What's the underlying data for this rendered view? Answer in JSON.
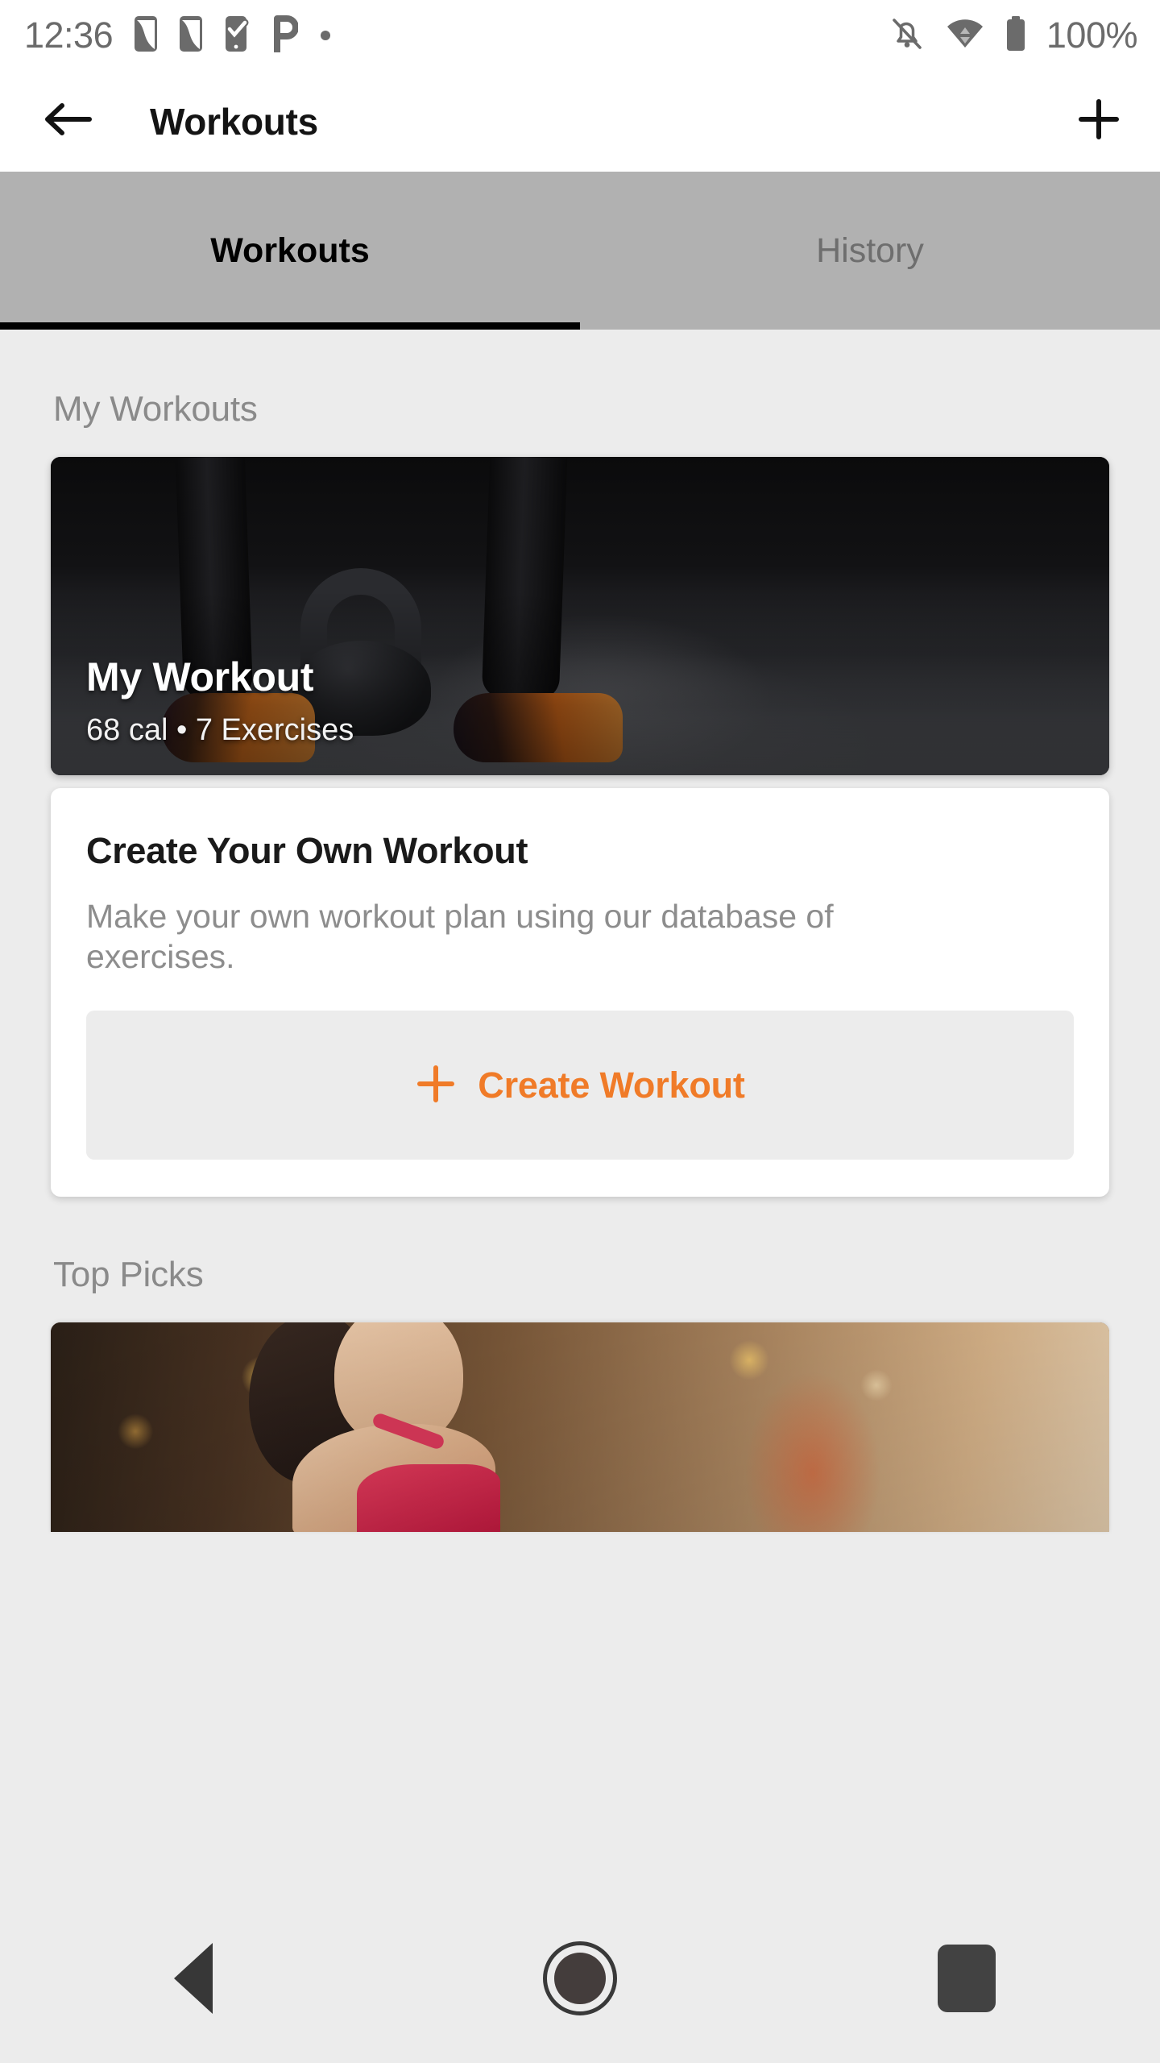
{
  "status_bar": {
    "time": "12:36",
    "battery_text": "100%",
    "left_icons": [
      "sim-card-icon",
      "sim-card-icon",
      "phone-check-icon",
      "pinterest-p-icon",
      "dot-icon"
    ],
    "right_icons": [
      "bell-off-icon",
      "wifi-icon",
      "battery-full-icon"
    ],
    "icon_color": "#6b6b6b"
  },
  "app_bar": {
    "back_icon": "arrow-left-icon",
    "title": "Workouts",
    "add_icon": "plus-icon"
  },
  "tabs": {
    "items": [
      {
        "label": "Workouts",
        "active": true
      },
      {
        "label": "History",
        "active": false
      }
    ],
    "background": "#b1b1b1",
    "indicator_color": "#000000"
  },
  "sections": [
    {
      "title": "My Workouts"
    },
    {
      "title": "Top Picks"
    }
  ],
  "my_workout_card": {
    "title": "My Workout",
    "subtitle": "68 cal • 7 Exercises",
    "image_alt": "legs-with-kettlebell-photo"
  },
  "create_card": {
    "title": "Create Your Own Workout",
    "description": "Make your own workout plan using our database of exercises.",
    "button_label": "Create Workout",
    "button_icon": "plus-icon",
    "accent_color": "#F07B28",
    "button_background": "#ececec"
  },
  "top_picks_card": {
    "image_alt": "smiling-woman-in-gym-photo"
  },
  "nav_bar": {
    "back_icon": "nav-back-triangle-icon",
    "home_icon": "nav-home-circle-icon",
    "recents_icon": "nav-recents-square-icon"
  },
  "theme": {
    "page_background": "#ececec",
    "card_background": "#ffffff",
    "accent": "#F07B28",
    "muted_text": "#8a8a8a"
  }
}
